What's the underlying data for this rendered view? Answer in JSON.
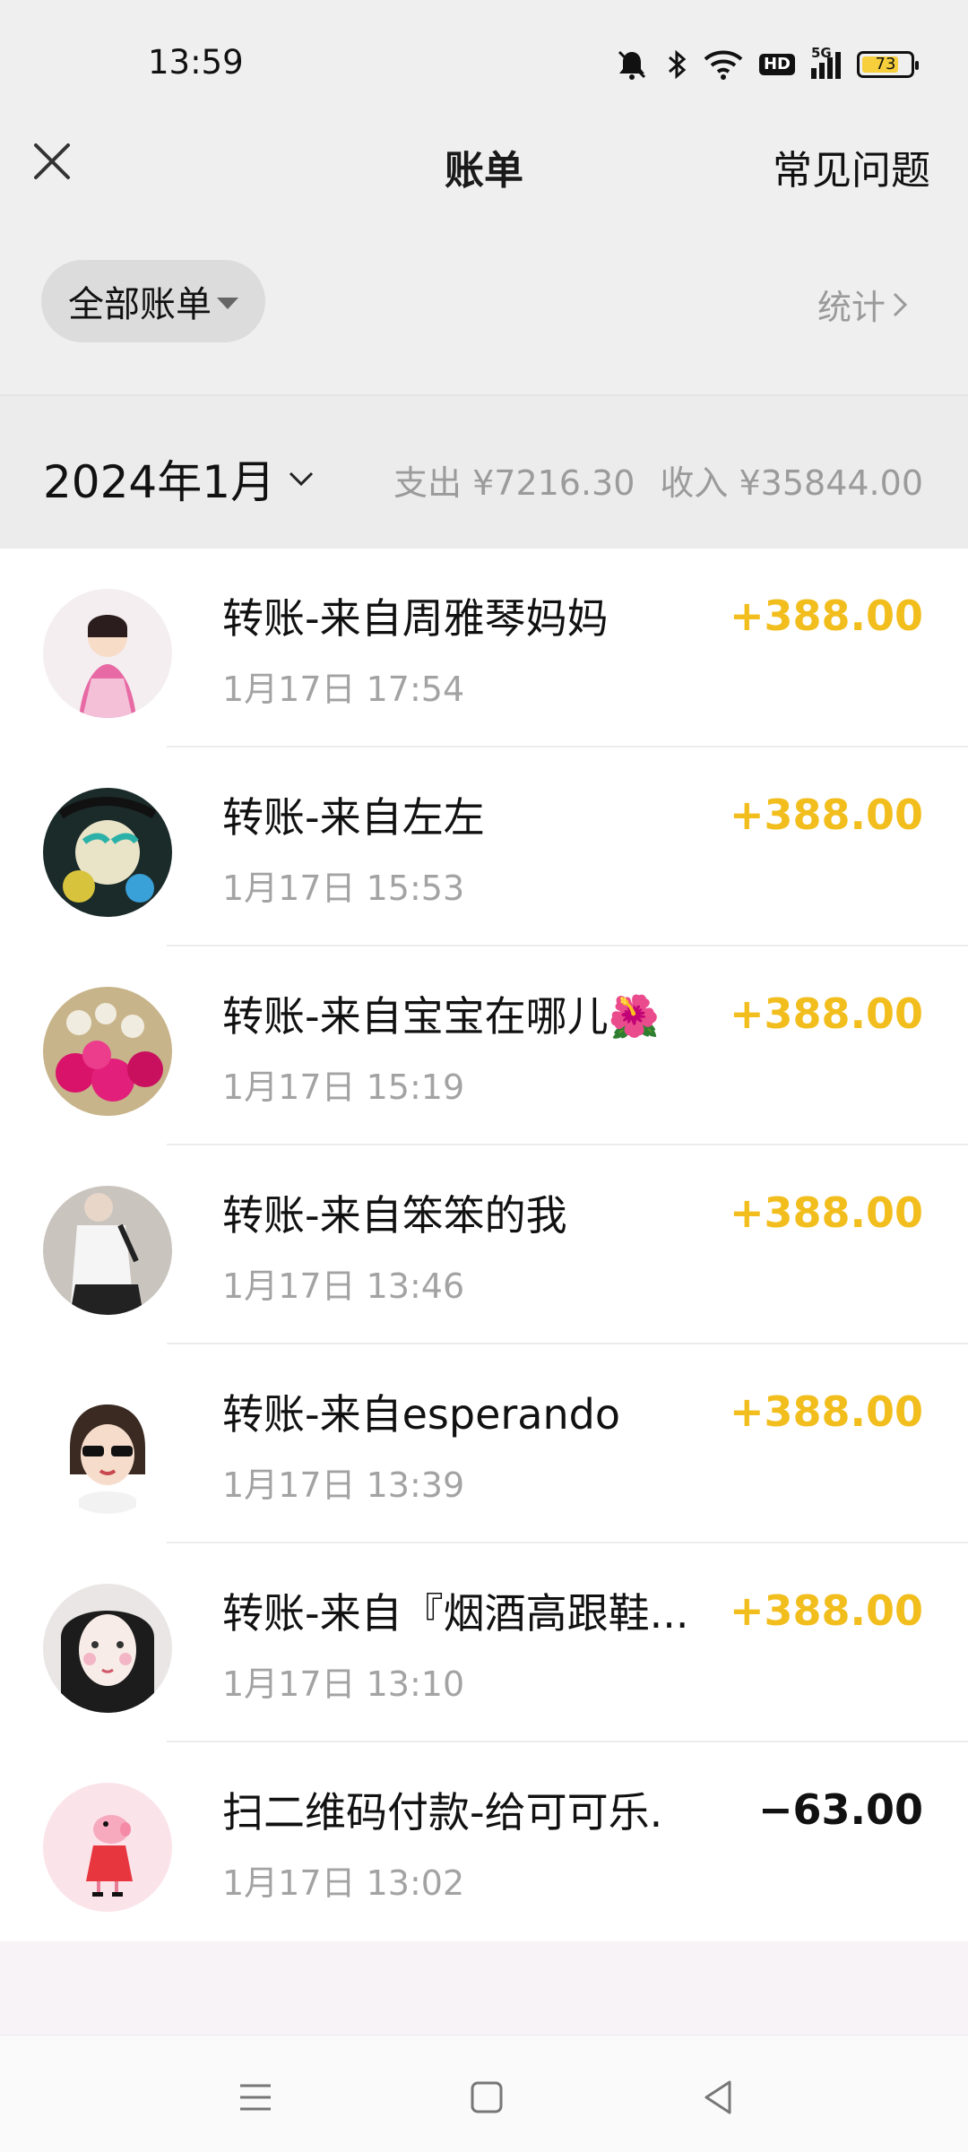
{
  "status": {
    "time": "13:59",
    "hd": "HD",
    "network": "5G",
    "battery": "73"
  },
  "header": {
    "title": "账单",
    "faq": "常见问题"
  },
  "filter": {
    "label": "全部账单",
    "stats": "统计"
  },
  "summary": {
    "month": "2024年1月",
    "expense": "支出 ¥7216.30",
    "income": "收入 ¥35844.00"
  },
  "transactions": [
    {
      "title": "转账-来自周雅琴妈妈",
      "time": "1月17日 17:54",
      "amount": "+388.00"
    },
    {
      "title": "转账-来自左左",
      "time": "1月17日 15:53",
      "amount": "+388.00"
    },
    {
      "title": "转账-来自宝宝在哪儿🌺",
      "time": "1月17日 15:19",
      "amount": "+388.00"
    },
    {
      "title": "转账-来自笨笨的我",
      "time": "1月17日 13:46",
      "amount": "+388.00"
    },
    {
      "title": "转账-来自esperando",
      "time": "1月17日 13:39",
      "amount": "+388.00"
    },
    {
      "title": "转账-来自『烟酒高跟鞋...",
      "time": "1月17日 13:10",
      "amount": "+388.00"
    },
    {
      "title": "扫二维码付款-给可可乐.",
      "time": "1月17日 13:02",
      "amount": "−63.00"
    }
  ],
  "colors": {
    "income": "#f2be1d",
    "expense": "#111111",
    "muted": "#9b9b9b"
  }
}
